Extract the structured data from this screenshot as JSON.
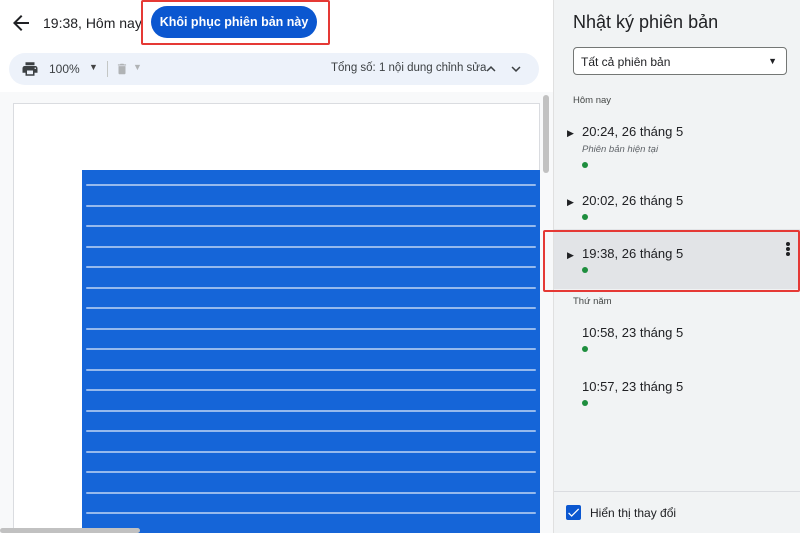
{
  "header": {
    "version_time": "19:38, Hôm nay",
    "restore_label": "Khôi phục phiên bản này"
  },
  "toolbar": {
    "zoom": "100%",
    "total_edits": "Tổng số: 1 nội dung chỉnh sửa"
  },
  "panel": {
    "title": "Nhật ký phiên bản",
    "filter_value": "Tất cả phiên bản",
    "sections": [
      {
        "label": "Hôm nay",
        "versions": [
          {
            "time": "20:24, 26 tháng 5",
            "subtitle": "Phiên bản hiện tại"
          },
          {
            "time": "20:02, 26 tháng 5"
          },
          {
            "time": "19:38, 26 tháng 5",
            "selected": true
          }
        ]
      },
      {
        "label": "Thứ năm",
        "versions": [
          {
            "time": "10:58, 23 tháng 5"
          },
          {
            "time": "10:57, 23 tháng 5"
          }
        ]
      }
    ],
    "show_changes_label": "Hiển thị thay đổi",
    "show_changes_checked": true
  },
  "colors": {
    "accent": "#0b57d0",
    "highlight_outline": "#e53935",
    "dot": "#1e8e3e",
    "image_fill": "#1565d8"
  },
  "icons": [
    "arrow-back-icon",
    "print-icon",
    "trash-icon",
    "chevron-up-icon",
    "chevron-down-icon",
    "kebab-icon",
    "checkbox-checked-icon"
  ]
}
